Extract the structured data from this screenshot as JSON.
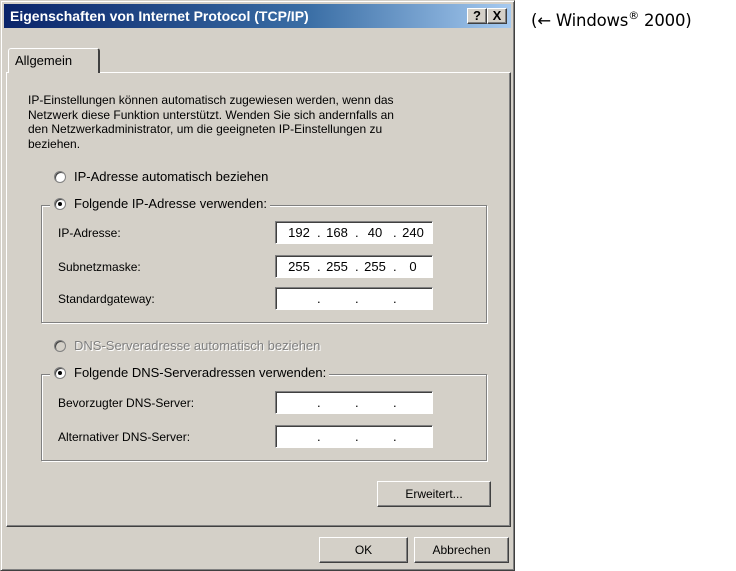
{
  "annotation": {
    "arrow": "(← ",
    "text": "Windows",
    "sup": "®",
    "tail": " 2000)"
  },
  "window": {
    "title": "Eigenschaften von Internet Protocol (TCP/IP)",
    "help_label": "?",
    "close_label": "X"
  },
  "tab": {
    "label": "Allgemein"
  },
  "description": {
    "lines": [
      "IP-Einstellungen können automatisch zugewiesen werden, wenn das",
      "Netzwerk diese Funktion unterstützt. Wenden Sie sich andernfalls an",
      "den Netzwerkadministrator, um die geeigneten IP-Einstellungen zu",
      "beziehen."
    ]
  },
  "ip": {
    "auto_label": "IP-Adresse automatisch beziehen",
    "auto_checked": false,
    "manual_label": "Folgende IP-Adresse verwenden:",
    "manual_checked": true,
    "fields": [
      {
        "label": "IP-Adresse:",
        "octets": [
          "192",
          "168",
          "40",
          "240"
        ]
      },
      {
        "label": "Subnetzmaske:",
        "octets": [
          "255",
          "255",
          "255",
          "0"
        ]
      },
      {
        "label": "Standardgateway:",
        "octets": [
          "",
          "",
          "",
          ""
        ]
      }
    ]
  },
  "dns": {
    "auto_label": "DNS-Serveradresse automatisch beziehen",
    "auto_checked": false,
    "auto_disabled": true,
    "manual_label": "Folgende DNS-Serveradressen verwenden:",
    "manual_checked": true,
    "fields": [
      {
        "label": "Bevorzugter DNS-Server:",
        "octets": [
          "",
          "",
          "",
          ""
        ]
      },
      {
        "label": "Alternativer DNS-Server:",
        "octets": [
          "",
          "",
          "",
          ""
        ]
      }
    ]
  },
  "buttons": {
    "advanced": "Erweitert...",
    "ok": "OK",
    "cancel": "Abbrechen"
  },
  "colors": {
    "dialog_bg": "#d4d0c8",
    "title_start": "#0a246a",
    "title_end": "#a6caf0",
    "disabled_text": "#808080"
  }
}
